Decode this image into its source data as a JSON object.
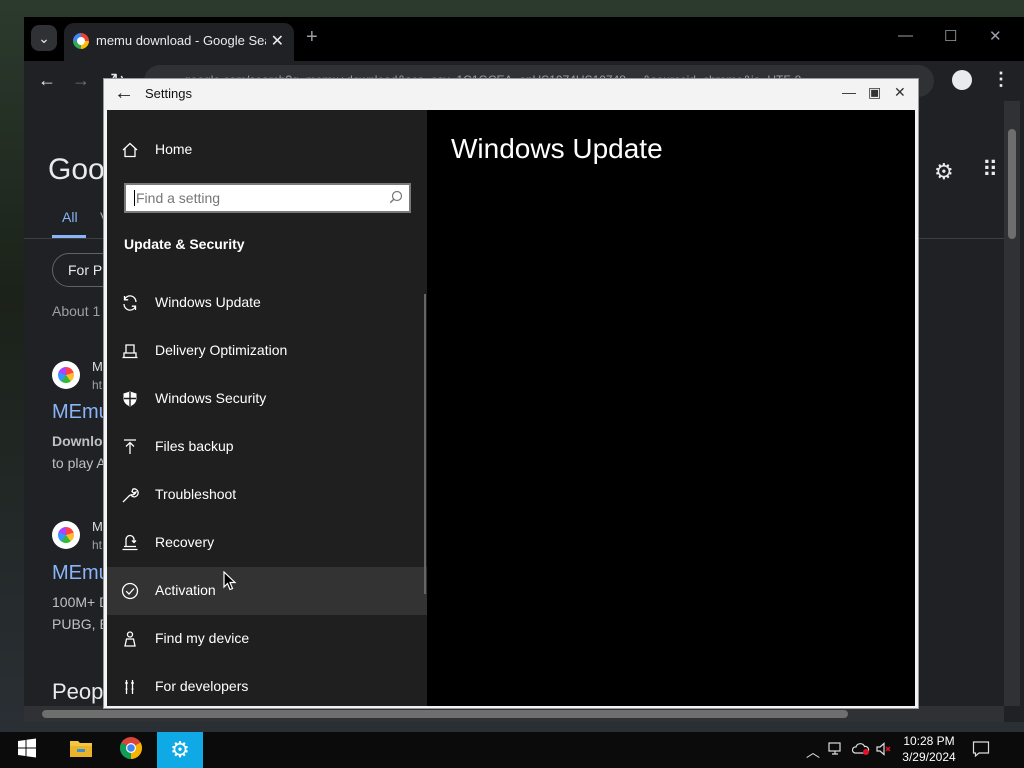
{
  "chrome": {
    "tab_title": "memu download - Google Search",
    "omnibox_text": "google.com/search?q=memu+download&sca_esv=1C1GCEA_enUS1074US10748 ... &sourceid=chrome&ie=UTF-8",
    "page": {
      "logo": "Goo",
      "tab_all": "All",
      "tab_next": "V",
      "chip": "For P",
      "about": "About 1",
      "results": [
        {
          "site": "M",
          "url": "ht",
          "title": "MEmu",
          "snippet1": "Downlo",
          "snippet2": "to play A"
        },
        {
          "site": "M",
          "url": "ht",
          "title": "MEmu",
          "snippet1": "100M+ D",
          "snippet2": "PUBG, E"
        }
      ],
      "people_heading": "Peop"
    }
  },
  "settings": {
    "window_title": "Settings",
    "home_label": "Home",
    "search_placeholder": "Find a setting",
    "section_heading": "Update & Security",
    "nav_items": [
      {
        "label": "Windows Update",
        "icon": "refresh-icon"
      },
      {
        "label": "Delivery Optimization",
        "icon": "delivery-optimization-icon"
      },
      {
        "label": "Windows Security",
        "icon": "shield-icon"
      },
      {
        "label": "Files backup",
        "icon": "upload-arrow-icon"
      },
      {
        "label": "Troubleshoot",
        "icon": "wrench-icon"
      },
      {
        "label": "Recovery",
        "icon": "recovery-icon"
      },
      {
        "label": "Activation",
        "icon": "check-circle-icon"
      },
      {
        "label": "Find my device",
        "icon": "person-location-icon"
      },
      {
        "label": "For developers",
        "icon": "developer-tools-icon"
      }
    ],
    "active_item": "Activation",
    "page_title": "Windows Update"
  },
  "taskbar": {
    "time": "10:28 PM",
    "date": "3/29/2024",
    "apps": [
      "start-icon",
      "file-explorer-icon",
      "chrome-icon",
      "settings-gear-icon"
    ],
    "active_app": "settings-gear-icon"
  },
  "colors": {
    "settings_nav_bg": "#1f1f1f",
    "settings_hover": "#333333",
    "taskbar_active": "#0fa9e6",
    "google_link": "#8ab4f8"
  }
}
